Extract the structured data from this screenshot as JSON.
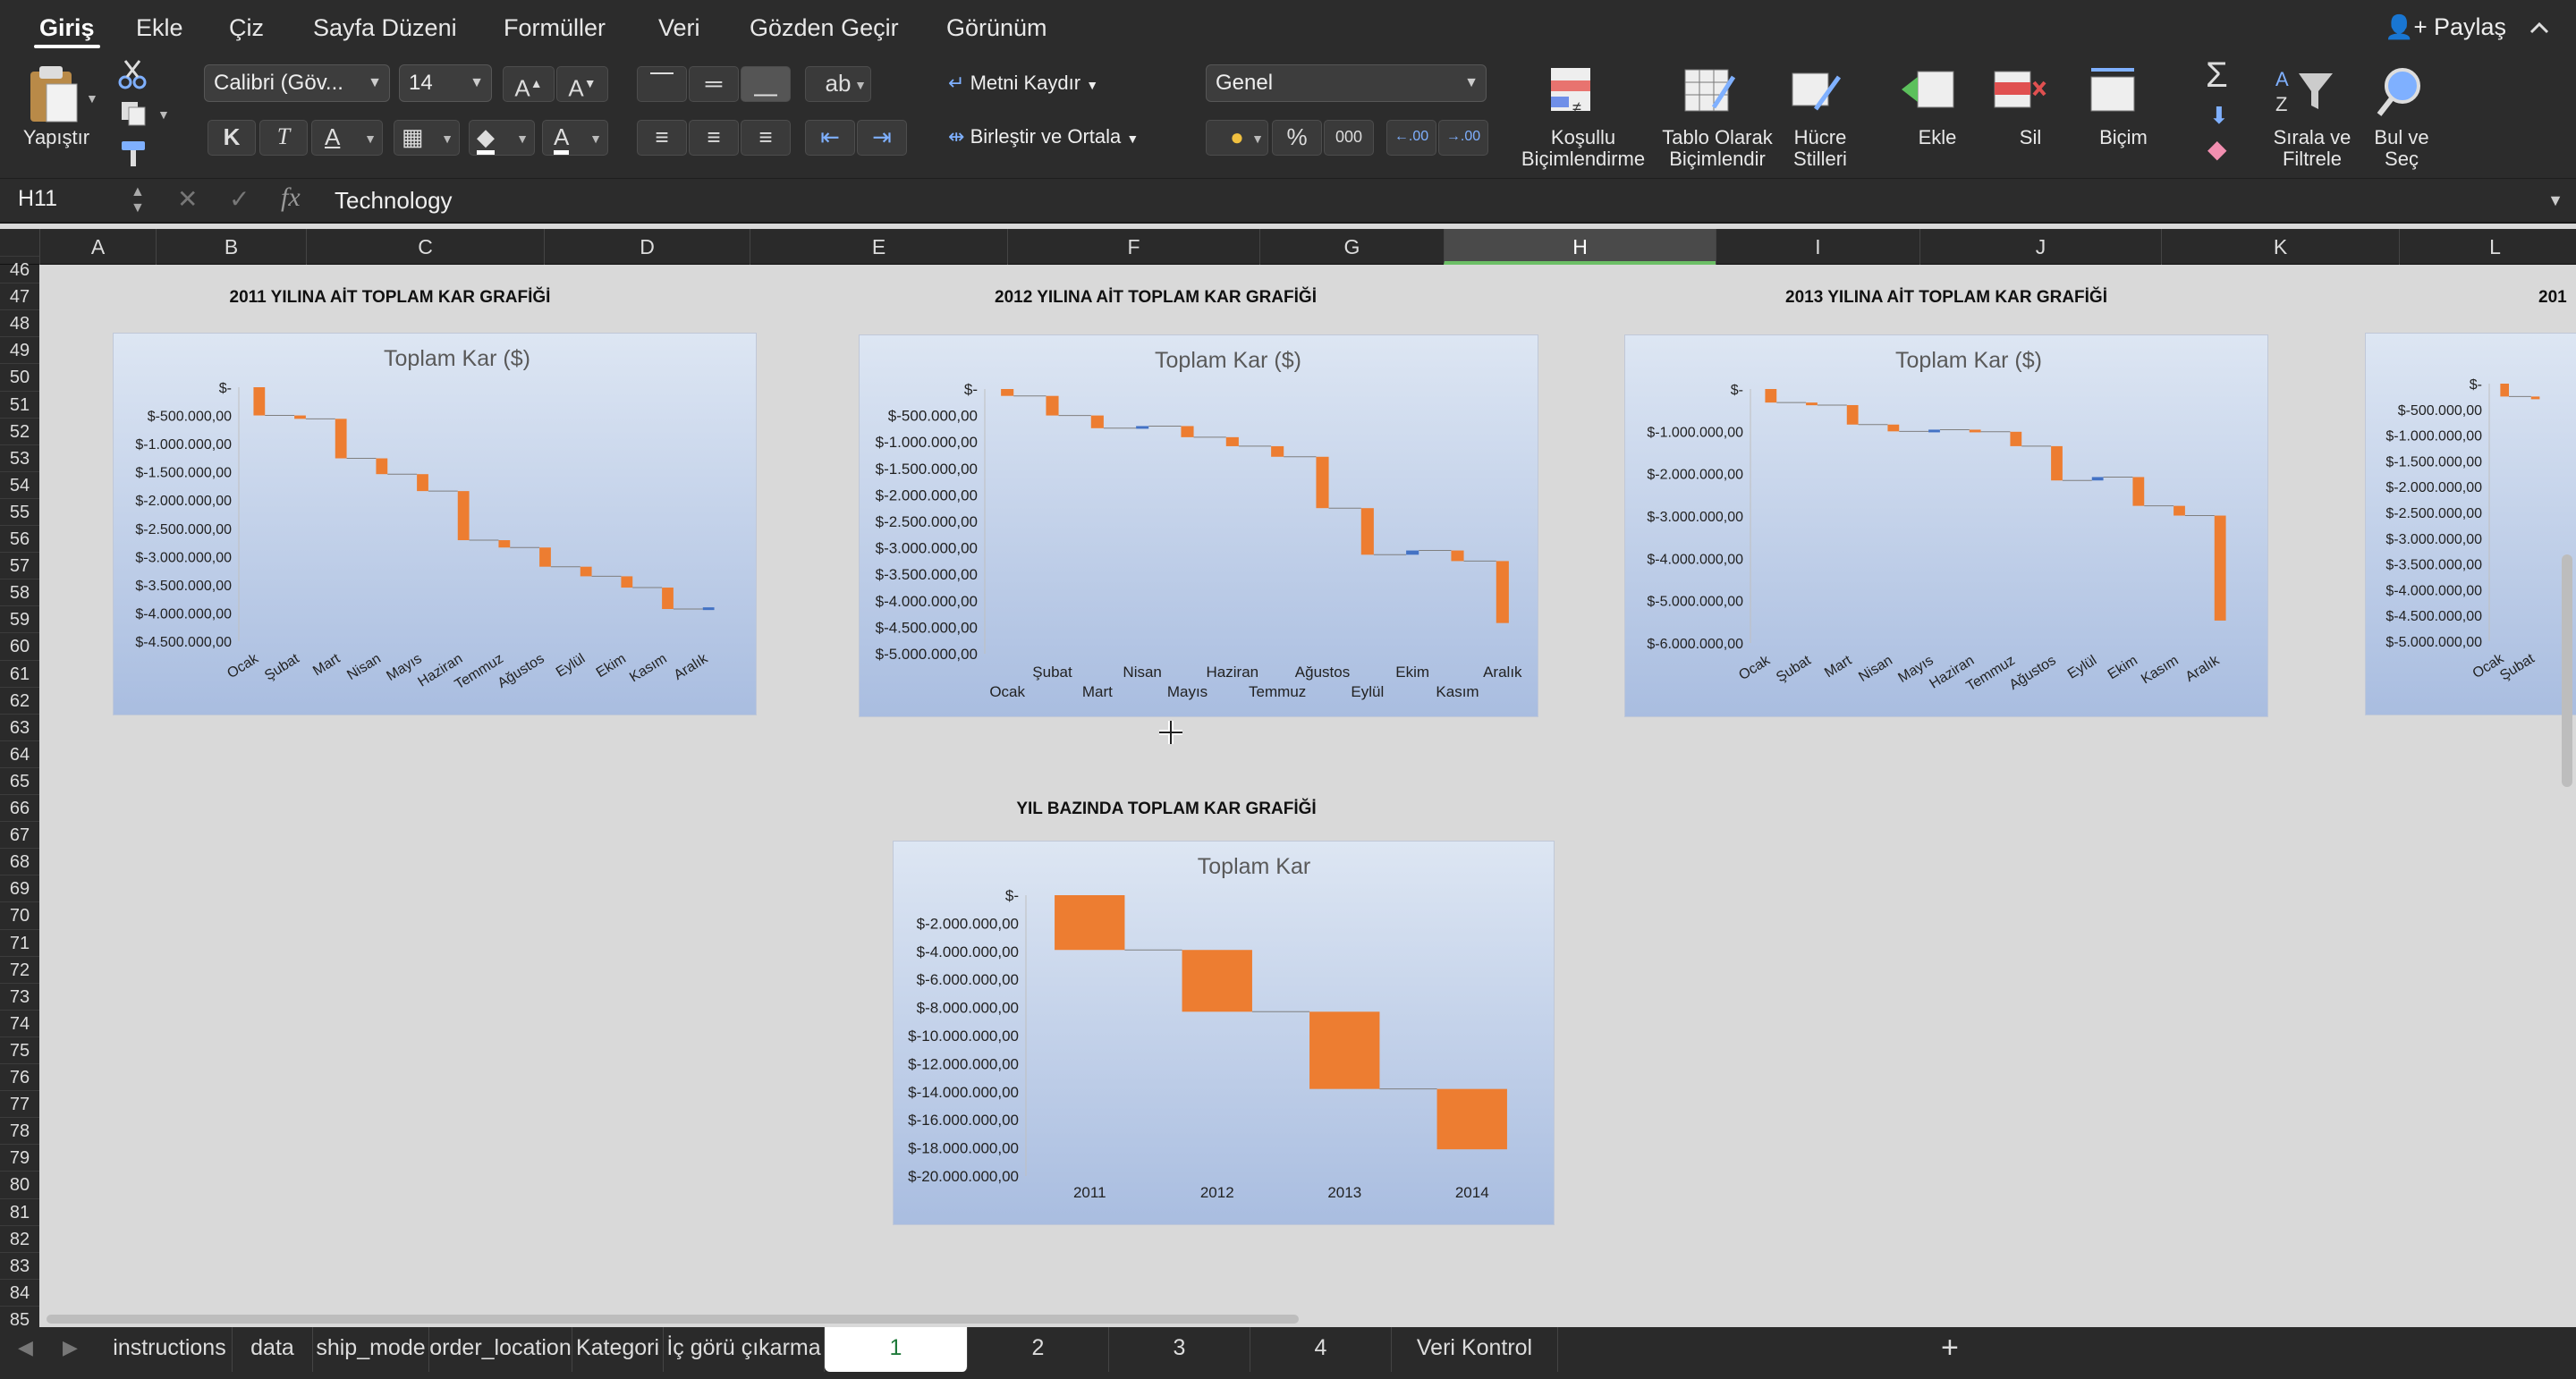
{
  "menu": {
    "tabs": [
      "Giriş",
      "Ekle",
      "Çiz",
      "Sayfa Düzeni",
      "Formüller",
      "Veri",
      "Gözden Geçir",
      "Görünüm"
    ],
    "share": "Paylaş"
  },
  "ribbon": {
    "paste": "Yapıştır",
    "font_name": "Calibri (Göv...",
    "font_size": "14",
    "wrap_text": "Metni Kaydır",
    "merge_center": "Birleştir ve Ortala",
    "number_format": "Genel",
    "bold": "K",
    "italic": "T",
    "underline": "A",
    "percent": "%",
    "thousands": "000",
    "inc_dec": ".00",
    "cond_format": [
      "Koşullu",
      "Biçimlendirme"
    ],
    "format_table": [
      "Tablo Olarak",
      "Biçimlendir"
    ],
    "cell_styles": [
      "Hücre",
      "Stilleri"
    ],
    "insert": "Ekle",
    "delete": "Sil",
    "format": "Biçim",
    "sort_filter": [
      "Sırala ve",
      "Filtrele"
    ],
    "find_select": [
      "Bul ve",
      "Seç"
    ]
  },
  "formula_bar": {
    "name_box": "H11",
    "fx": "fx",
    "value": "Technology"
  },
  "columns": [
    "A",
    "B",
    "C",
    "D",
    "E",
    "F",
    "G",
    "H",
    "I",
    "J",
    "K",
    "L"
  ],
  "selected_column": "H",
  "rows": [
    "46",
    "47",
    "48",
    "49",
    "50",
    "51",
    "52",
    "53",
    "54",
    "55",
    "56",
    "57",
    "58",
    "59",
    "60",
    "61",
    "62",
    "63",
    "64",
    "65",
    "66",
    "67",
    "68",
    "69",
    "70",
    "71",
    "72",
    "73",
    "74",
    "75",
    "76",
    "77",
    "78",
    "79",
    "80",
    "81",
    "82",
    "83",
    "84",
    "85"
  ],
  "sheet_tabs": [
    "instructions",
    "data",
    "ship_mode",
    "order_location",
    "Kategori",
    "İç görü çıkarma",
    "1",
    "2",
    "3",
    "4",
    "Veri Kontrol"
  ],
  "active_sheet": "1",
  "colors": {
    "increase_bar": "#ed7d31",
    "positive_bar": "#4472c4",
    "connector": "#7f7f7f",
    "plot_bg_top": "#dde6f3",
    "plot_bg_bottom": "#a9bde0"
  },
  "chart_titles": {
    "c2011": "2011 YILINA AİT TOPLAM KAR  GRAFİĞİ",
    "c2012": "2012 YILINA AİT TOPLAM KAR  GRAFİĞİ",
    "c2013": "2013 YILINA AİT TOPLAM KAR  GRAFİĞİ",
    "c2014": "201",
    "cyear": "YIL BAZINDA TOPLAM KAR GRAFİĞİ"
  },
  "chart_data": [
    {
      "id": "c2011",
      "type": "waterfall",
      "title": "Toplam Kar ($)",
      "ylim": [
        -4500000,
        0
      ],
      "yticks": [
        "$-",
        "$-500.000,00",
        "$-1.000.000,00",
        "$-1.500.000,00",
        "$-2.000.000,00",
        "$-2.500.000,00",
        "$-3.000.000,00",
        "$-3.500.000,00",
        "$-4.000.000,00",
        "$-4.500.000,00"
      ],
      "categories": [
        "Ocak",
        "Şubat",
        "Mart",
        "Nisan",
        "Mayıs",
        "Haziran",
        "Temmuz",
        "Ağustos",
        "Eylül",
        "Ekim",
        "Kasım",
        "Aralık"
      ],
      "values": [
        -500000,
        -60000,
        -700000,
        -280000,
        -300000,
        -870000,
        -130000,
        -340000,
        -170000,
        -200000,
        -380000,
        30000
      ]
    },
    {
      "id": "c2012",
      "type": "waterfall",
      "title": "Toplam Kar ($)",
      "ylim": [
        -5000000,
        0
      ],
      "yticks": [
        "$-",
        "$-500.000,00",
        "$-1.000.000,00",
        "$-1.500.000,00",
        "$-2.000.000,00",
        "$-2.500.000,00",
        "$-3.000.000,00",
        "$-3.500.000,00",
        "$-4.000.000,00",
        "$-4.500.000,00",
        "$-5.000.000,00"
      ],
      "categories": [
        "Ocak",
        "Şubat",
        "Mart",
        "Nisan",
        "Mayıs",
        "Haziran",
        "Temmuz",
        "Ağustos",
        "Eylül",
        "Ekim",
        "Kasım",
        "Aralık"
      ],
      "values": [
        -130000,
        -370000,
        -240000,
        40000,
        -210000,
        -170000,
        -200000,
        -970000,
        -880000,
        80000,
        -200000,
        -1170000
      ]
    },
    {
      "id": "c2013",
      "type": "waterfall",
      "title": "Toplam Kar ($)",
      "ylim": [
        -6000000,
        0
      ],
      "yticks": [
        "$-",
        "$-1.000.000,00",
        "$-2.000.000,00",
        "$-3.000.000,00",
        "$-4.000.000,00",
        "$-5.000.000,00",
        "$-6.000.000,00"
      ],
      "categories": [
        "Ocak",
        "Şubat",
        "Mart",
        "Nisan",
        "Mayıs",
        "Haziran",
        "Temmuz",
        "Ağustos",
        "Eylül",
        "Ekim",
        "Kasım",
        "Aralık"
      ],
      "values": [
        -320000,
        -60000,
        -460000,
        -160000,
        40000,
        -50000,
        -340000,
        -810000,
        80000,
        -680000,
        -230000,
        -2480000
      ]
    },
    {
      "id": "c2014",
      "type": "waterfall",
      "title": "",
      "ylim": [
        -5000000,
        0
      ],
      "yticks": [
        "$-",
        "$-500.000,00",
        "$-1.000.000,00",
        "$-1.500.000,00",
        "$-2.000.000,00",
        "$-2.500.000,00",
        "$-3.000.000,00",
        "$-3.500.000,00",
        "$-4.000.000,00",
        "$-4.500.000,00",
        "$-5.000.000,00"
      ],
      "categories": [
        "Ocak",
        "Şubat"
      ],
      "values": [
        -250000,
        -40000
      ]
    },
    {
      "id": "cyear",
      "type": "waterfall",
      "title": "Toplam Kar",
      "ylim": [
        -20000000,
        0
      ],
      "yticks": [
        "$-",
        "$-2.000.000,00",
        "$-4.000.000,00",
        "$-6.000.000,00",
        "$-8.000.000,00",
        "$-10.000.000,00",
        "$-12.000.000,00",
        "$-14.000.000,00",
        "$-16.000.000,00",
        "$-18.000.000,00",
        "$-20.000.000,00"
      ],
      "categories": [
        "2011",
        "2012",
        "2013",
        "2014"
      ],
      "values": [
        -3900000,
        -4400000,
        -5500000,
        -4300000
      ]
    }
  ]
}
